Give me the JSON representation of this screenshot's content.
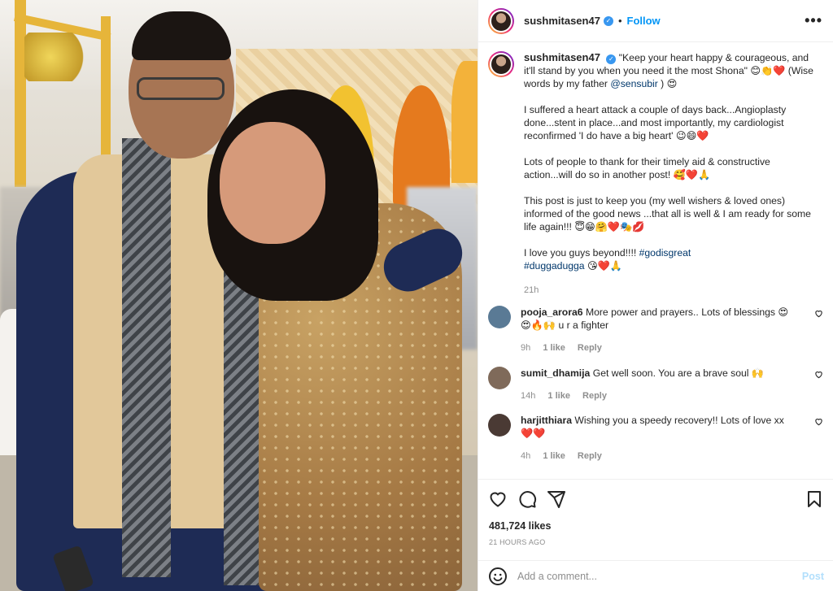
{
  "post": {
    "username": "sushmitasen47",
    "verified_icon": "verified-badge-icon",
    "follow_label": "Follow",
    "separator": "•",
    "more_label": "•••",
    "caption": {
      "username": "sushmitasen47",
      "p1": "\"Keep your heart happy & courageous, and it'll stand by you when you need it the most Shona\" 😊👏❤️ (Wise words by my father ",
      "p1_mention": "@sensubir",
      "p1_end": " ) 😍",
      "p2": "I suffered a heart attack a couple of days back...Angioplasty done...stent in place...and most importantly, my cardiologist reconfirmed 'I do have a big heart' 😉😄❤️",
      "p3": "Lots of people to thank for their timely aid & constructive action...will do so in another post! 🥰❤️🙏",
      "p4": "This post is just to keep you (my well wishers & loved ones) informed of the good news ...that all is well & I am ready for some life again!!! 😇😁🤗❤️🎭💋",
      "p5": "I love you guys beyond!!!! ",
      "p5_tag1": "#godisgreat",
      "p5_tag2": "#duggadugga",
      "p5_end": " 😘❤️🙏",
      "time": "21h"
    },
    "comments": [
      {
        "user": "pooja_arora6",
        "text": "More power and prayers.. Lots of blessings 😍😍🔥🙌 u r a fighter",
        "time": "9h",
        "likes": "1 like",
        "reply": "Reply",
        "avatar_color": "#5a7a95"
      },
      {
        "user": "sumit_dhamija",
        "text": "Get well soon. You are a brave soul 🙌",
        "time": "14h",
        "likes": "1 like",
        "reply": "Reply",
        "avatar_color": "#7f6a5a"
      },
      {
        "user": "harjitthiara",
        "text": "Wishing you a speedy recovery!! Lots of love xx ❤️❤️",
        "time": "4h",
        "likes": "1 like",
        "reply": "Reply",
        "avatar_color": "#4a3a34"
      }
    ],
    "actions": {
      "like_icon": "heart-icon",
      "comment_icon": "comment-icon",
      "share_icon": "share-icon",
      "save_icon": "bookmark-icon"
    },
    "likes": "481,724 likes",
    "posted_ago": "21 HOURS AGO",
    "add_comment": {
      "emoji_icon": "emoji-icon",
      "placeholder": "Add a comment...",
      "post_label": "Post"
    }
  },
  "colors": {
    "link": "#00376b",
    "accent": "#0095f6",
    "muted": "#8e8e8e",
    "post_disabled": "#b2dffc"
  }
}
